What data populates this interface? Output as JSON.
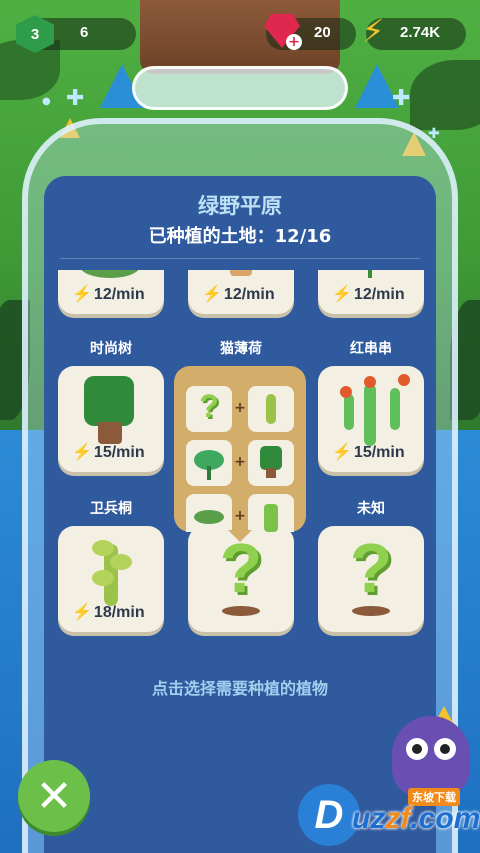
{
  "hud": {
    "level": "3",
    "level_progress": "6",
    "gems": "20",
    "gem_plus": "+",
    "energy": "2.74K"
  },
  "panel": {
    "title": "绿野平原",
    "subtitle": "已种植的土地：12/16",
    "hint": "点击选择需要种植的植物"
  },
  "top_row": [
    {
      "rate": "12/min"
    },
    {
      "rate": "12/min"
    },
    {
      "rate": "12/min"
    }
  ],
  "plants": [
    {
      "name": "时尚树",
      "rate": "15/min"
    },
    {
      "name": "猫薄荷"
    },
    {
      "name": "红串串",
      "rate": "15/min"
    },
    {
      "name": "卫兵桐",
      "rate": "18/min"
    },
    {
      "name": "未知"
    }
  ],
  "recipe": {
    "plus": "+",
    "unknown": "?"
  },
  "close_button": {
    "icon": "close-icon",
    "label": "✕"
  },
  "watermark": {
    "top_text": "东坡下载",
    "main_text_a": "uz",
    "main_text_b": "zf",
    "main_text_c": ".com",
    "circle": "D"
  },
  "colors": {
    "panel": "#2f5a9e",
    "card": "#f3efe3",
    "bolt": "#f2b21b",
    "gem": "#e0284f",
    "close": "#6cc04a"
  }
}
